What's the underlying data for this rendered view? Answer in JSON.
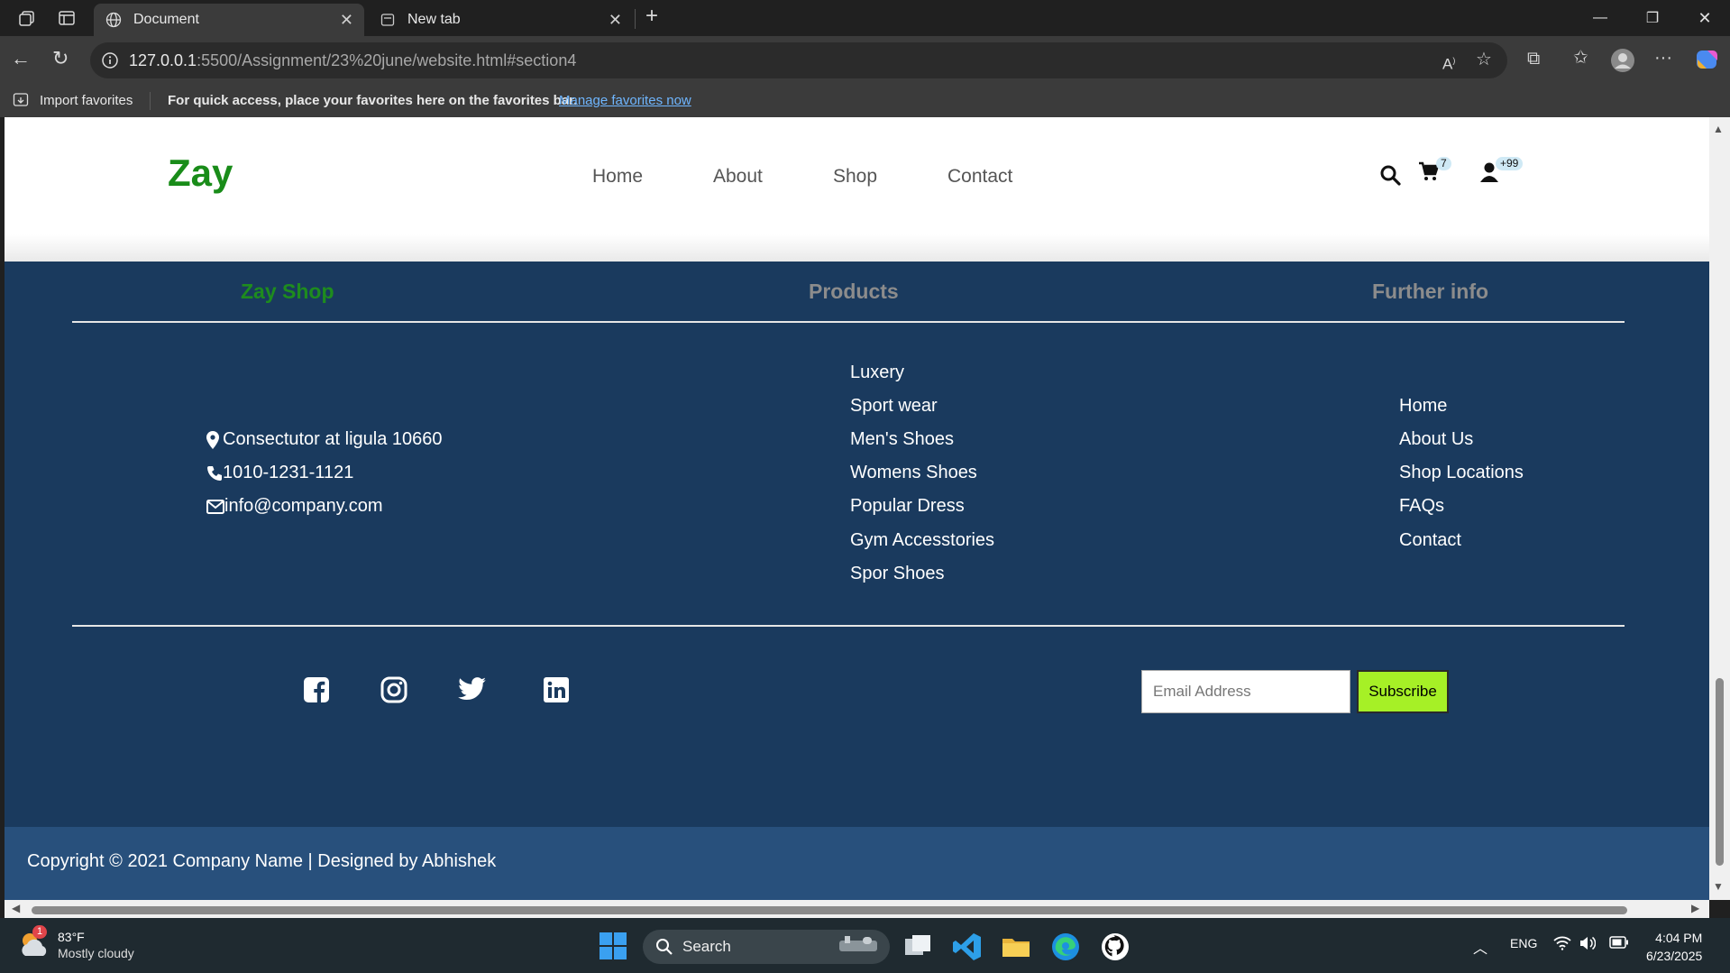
{
  "browser": {
    "tabs": [
      {
        "title": "Document"
      },
      {
        "title": "New tab"
      }
    ],
    "address": {
      "host": "127.0.0.1",
      "path": ":5500/Assignment/23%20june/website.html#section4"
    },
    "favorites_bar": {
      "import_label": "Import favorites",
      "message": "For quick access, place your favorites here on the favorites bar.",
      "link": "Manage favorites now"
    }
  },
  "site": {
    "logo": "Zay",
    "nav": [
      "Home",
      "About",
      "Shop",
      "Contact"
    ],
    "cart_count": "7",
    "user_count": "+99"
  },
  "footer": {
    "headings": {
      "brand": "Zay Shop",
      "products": "Products",
      "info": "Further info"
    },
    "contact": {
      "address": "Consectutor at ligula 10660",
      "phone": "1010-1231-1121",
      "email": "info@company.com"
    },
    "products": [
      "Luxery",
      "Sport wear",
      "Men's Shoes",
      "Womens Shoes",
      "Popular Dress",
      "Gym Accesstories",
      "Spor Shoes"
    ],
    "further_info": [
      "Home",
      "About Us",
      "Shop Locations",
      "FAQs",
      "Contact"
    ],
    "email_placeholder": "Email Address",
    "subscribe_label": "Subscribe",
    "copyright": "Copyright © 2021 Company Name | Designed by Abhishek"
  },
  "taskbar": {
    "weather_temp": "83°F",
    "weather_desc": "Mostly cloudy",
    "weather_badge": "1",
    "search_label": "Search",
    "language": "ENG",
    "time": "4:04 PM",
    "date": "6/23/2025"
  },
  "colors": {
    "footer_bg": "#1a3a5e",
    "copyright_bg": "#28507c",
    "brand_green": "#198c19",
    "subscribe_bg": "#a6f026"
  }
}
